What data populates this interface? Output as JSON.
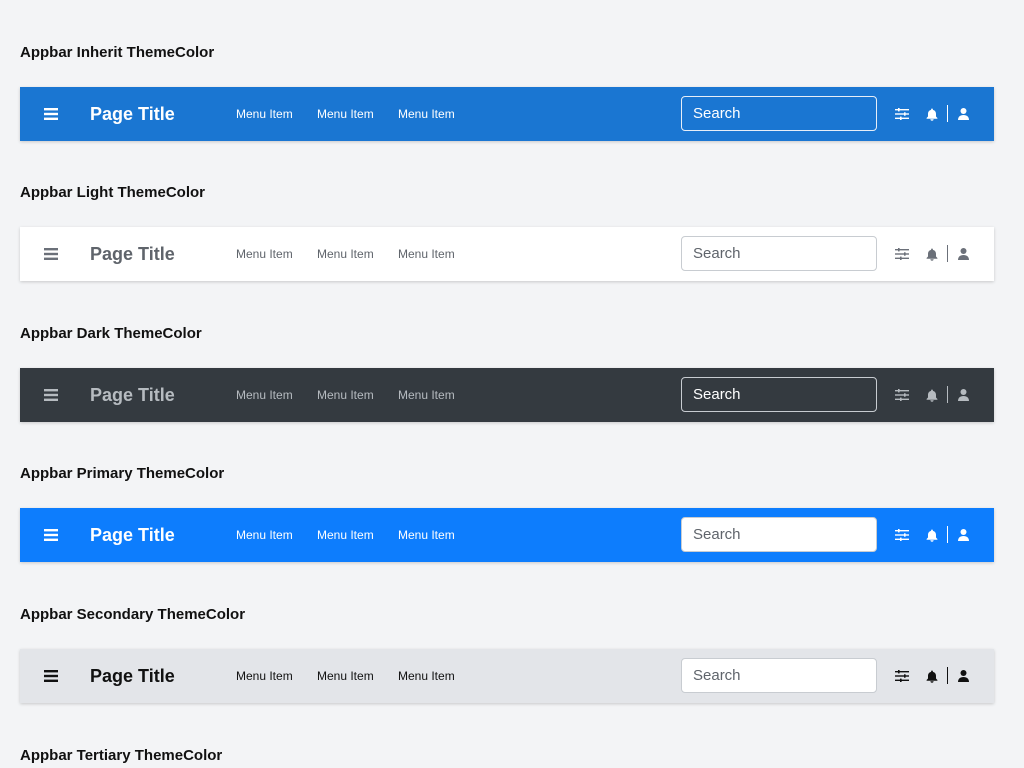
{
  "sections": [
    {
      "heading": "Appbar Inherit ThemeColor",
      "title": "Page Title",
      "menu": [
        "Menu Item",
        "Menu Item",
        "Menu Item"
      ],
      "search_placeholder": "Search"
    },
    {
      "heading": "Appbar Light ThemeColor",
      "title": "Page Title",
      "menu": [
        "Menu Item",
        "Menu Item",
        "Menu Item"
      ],
      "search_placeholder": "Search"
    },
    {
      "heading": "Appbar Dark ThemeColor",
      "title": "Page Title",
      "menu": [
        "Menu Item",
        "Menu Item",
        "Menu Item"
      ],
      "search_placeholder": "Search"
    },
    {
      "heading": "Appbar Primary ThemeColor",
      "title": "Page Title",
      "menu": [
        "Menu Item",
        "Menu Item",
        "Menu Item"
      ],
      "search_placeholder": "Search"
    },
    {
      "heading": "Appbar Secondary ThemeColor",
      "title": "Page Title",
      "menu": [
        "Menu Item",
        "Menu Item",
        "Menu Item"
      ],
      "search_placeholder": "Search"
    },
    {
      "heading": "Appbar Tertiary ThemeColor"
    }
  ],
  "icons": {
    "menu": "hamburger-menu-icon",
    "filter": "sliders-filter-icon",
    "notification": "bell-icon",
    "user": "user-icon"
  },
  "theme_colors": {
    "inherit": "#1a76d2",
    "light": "#ffffff",
    "dark": "#343a40",
    "primary": "#0d7dfd",
    "secondary": "#e3e5e9",
    "page_background": "#f3f4f6"
  }
}
